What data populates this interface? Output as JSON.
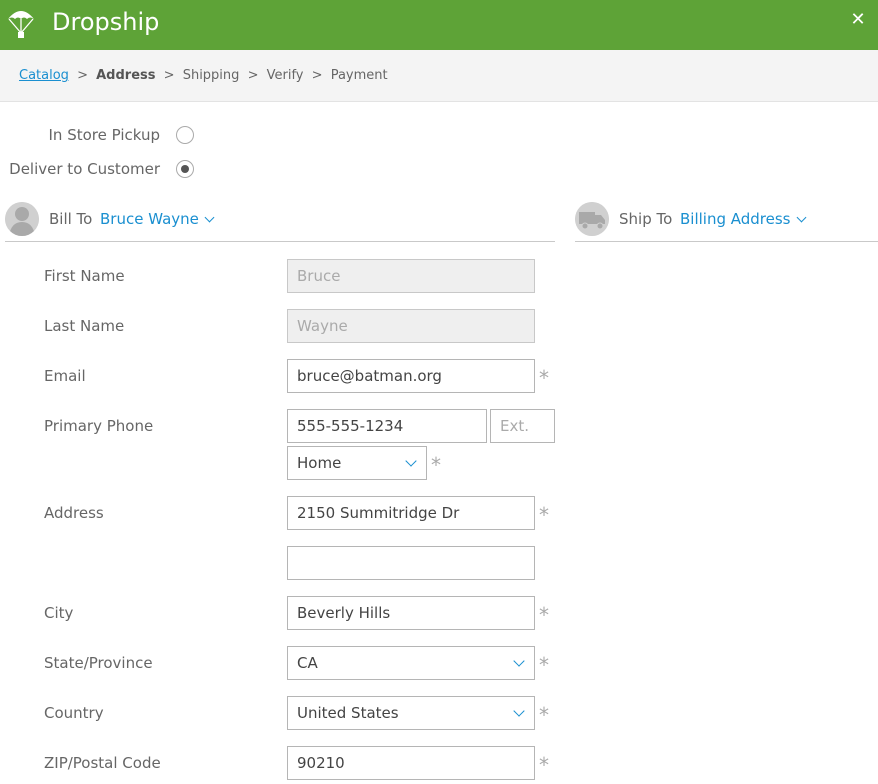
{
  "app": {
    "title": "Dropship",
    "close_glyph": "✕"
  },
  "breadcrumb": {
    "items": [
      "Catalog",
      "Address",
      "Shipping",
      "Verify",
      "Payment"
    ],
    "separator": ">",
    "current_index": 1
  },
  "fulfillment": {
    "options": [
      {
        "label": "In Store Pickup",
        "selected": false
      },
      {
        "label": "Deliver to Customer",
        "selected": true
      }
    ]
  },
  "bill_to": {
    "label": "Bill To",
    "value": "Bruce Wayne",
    "icon": "person-avatar-icon"
  },
  "ship_to": {
    "label": "Ship To",
    "value": "Billing Address",
    "icon": "truck-icon"
  },
  "form": {
    "required_mark": "*",
    "first_name": {
      "label": "First Name",
      "value": "Bruce",
      "disabled": true
    },
    "last_name": {
      "label": "Last Name",
      "value": "Wayne",
      "disabled": true
    },
    "email": {
      "label": "Email",
      "value": "bruce@batman.org",
      "required": true
    },
    "primary_phone": {
      "label": "Primary Phone",
      "value": "555-555-1234",
      "ext_placeholder": "Ext.",
      "type_value": "Home",
      "required": true
    },
    "address": {
      "label": "Address",
      "line1": "2150 Summitridge Dr",
      "line2": "",
      "required": true
    },
    "city": {
      "label": "City",
      "value": "Beverly Hills",
      "required": true
    },
    "state": {
      "label": "State/Province",
      "value": "CA",
      "required": true
    },
    "country": {
      "label": "Country",
      "value": "United States",
      "required": true
    },
    "zip": {
      "label": "ZIP/Postal Code",
      "value": "90210",
      "required": true
    }
  },
  "colors": {
    "titlebar": "#5ea337",
    "accent": "#1a8fd0",
    "text": "#666666"
  }
}
